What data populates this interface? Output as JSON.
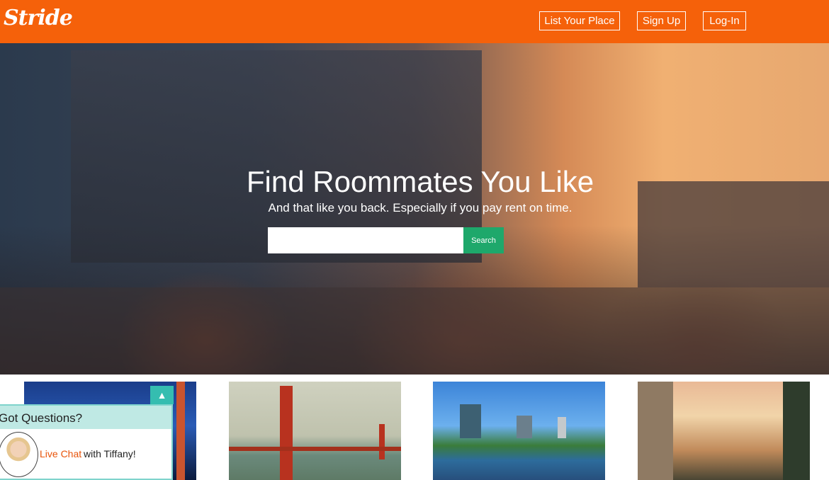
{
  "header": {
    "logo": "Stride",
    "nav": {
      "list_place": "List Your Place",
      "sign_up": "Sign Up",
      "log_in": "Log-In"
    },
    "background_color": "#f5610a"
  },
  "hero": {
    "title": "Find Roommates You Like",
    "subtitle": "And that like you back. Especially if you pay rent on time.",
    "search": {
      "value": "",
      "button_label": "Search",
      "button_color": "#1ea86b"
    }
  },
  "cities": [
    {
      "icon": "san-francisco-night-bridge-photo"
    },
    {
      "icon": "golden-gate-bridge-photo"
    },
    {
      "icon": "austin-skyline-photo"
    },
    {
      "icon": "los-angeles-palm-street-photo"
    }
  ],
  "chat": {
    "title": "Got Questions?",
    "link_text": "Live Chat",
    "with_text": "with Tiffany!",
    "toggle_icon": "chevron-up-icon",
    "link_color": "#e8540a",
    "header_color": "#bfe9e4"
  }
}
